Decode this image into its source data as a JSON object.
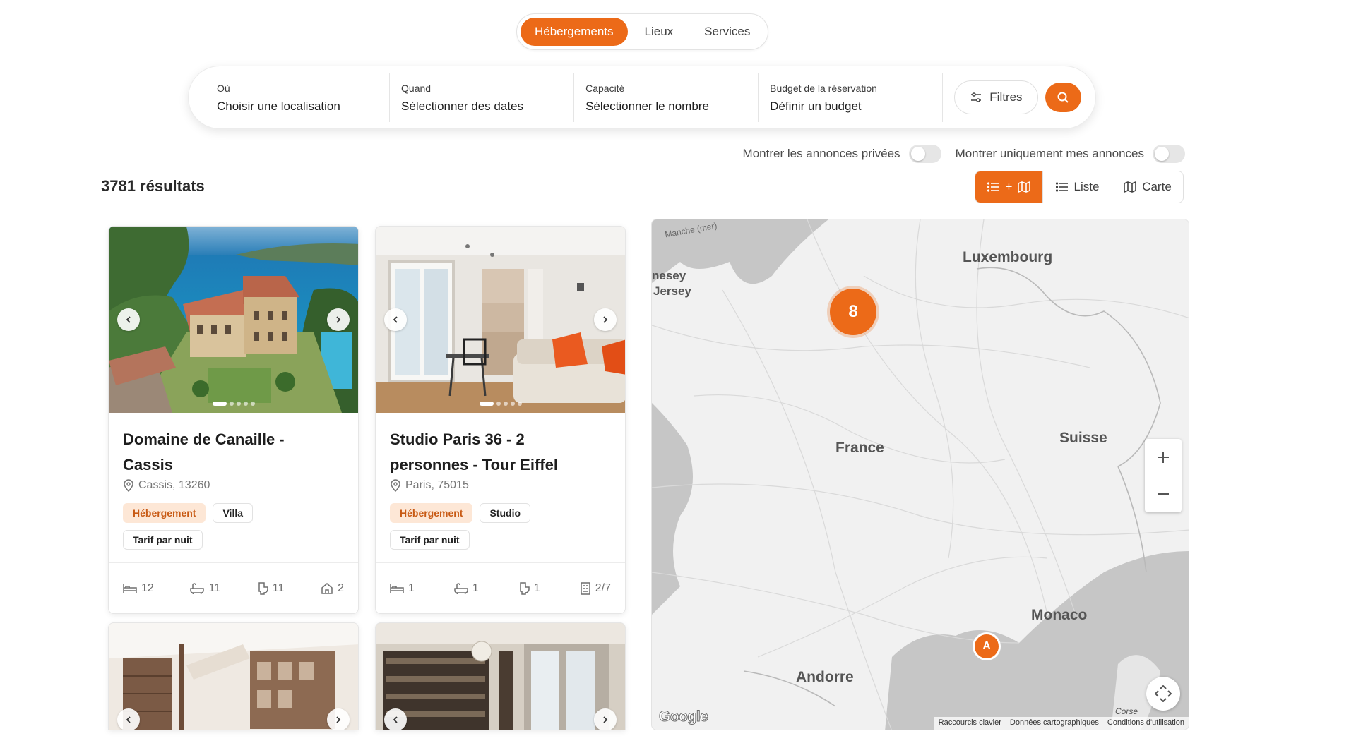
{
  "tabs": [
    {
      "label": "Hébergements",
      "active": true
    },
    {
      "label": "Lieux",
      "active": false
    },
    {
      "label": "Services",
      "active": false
    }
  ],
  "search": {
    "fields": [
      {
        "label": "Où",
        "value": "Choisir une localisation"
      },
      {
        "label": "Quand",
        "value": "Sélectionner des dates"
      },
      {
        "label": "Capacité",
        "value": "Sélectionner le nombre"
      },
      {
        "label": "Budget de la réservation",
        "value": "Définir un budget"
      }
    ],
    "filters_label": "Filtres"
  },
  "toggles": {
    "private": "Montrer les annonces privées",
    "mine": "Montrer uniquement mes annonces"
  },
  "results": {
    "count_label": "3781 résultats"
  },
  "view": {
    "combo_plus": "+",
    "list_label": "Liste",
    "map_label": "Carte"
  },
  "listings": [
    {
      "title_line1": "Domaine de Canaille -",
      "title_line2": "Cassis",
      "location": "Cassis, 13260",
      "tags": [
        "Hébergement",
        "Villa",
        "Tarif par nuit"
      ],
      "stats": {
        "beds": "12",
        "baths": "11",
        "toilets": "11",
        "rooms": "2"
      }
    },
    {
      "title_line1": "Studio Paris 36 - 2",
      "title_line2": "personnes - Tour Eiffel",
      "location": "Paris, 75015",
      "tags": [
        "Hébergement",
        "Studio",
        "Tarif par nuit"
      ],
      "stats": {
        "beds": "1",
        "baths": "1",
        "toilets": "1",
        "floor": "2/7"
      }
    }
  ],
  "map": {
    "labels": {
      "manche": "Manche (mer)",
      "guernesey": "nesey",
      "jersey": "Jersey",
      "luxembourg": "Luxembourg",
      "france": "France",
      "suisse": "Suisse",
      "monaco": "Monaco",
      "andorre": "Andorre",
      "corse": "Corse"
    },
    "clusters": [
      {
        "label": "8"
      },
      {
        "label": "A"
      }
    ],
    "google": "Google",
    "footer": [
      "Raccourcis clavier",
      "Données cartographiques",
      "Conditions d'utilisation"
    ]
  },
  "colors": {
    "accent": "#ec6a18",
    "tag_bg": "#fde7d6",
    "tag_text": "#c85a14"
  }
}
